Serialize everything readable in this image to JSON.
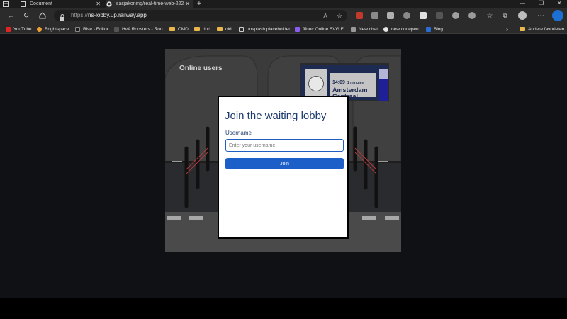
{
  "browser": {
    "tabs": [
      {
        "title": "Document",
        "active": false
      },
      {
        "title": "sasjakoning/real-time-web-2223",
        "active": true
      }
    ],
    "new_tab": "+",
    "url": {
      "scheme": "https://",
      "host": "ns-lobby.up.railway.app"
    },
    "bookmarks": [
      {
        "label": "YouTube"
      },
      {
        "label": "Brightspace"
      },
      {
        "label": "Rive - Editor"
      },
      {
        "label": "HvA Roosters - Roo..."
      },
      {
        "label": "CMD"
      },
      {
        "label": "dnd"
      },
      {
        "label": "old"
      },
      {
        "label": "unsplash placeholder"
      },
      {
        "label": "fffuuc Online SVG Fi..."
      },
      {
        "label": "New chat"
      },
      {
        "label": "new codepen"
      },
      {
        "label": "Bing"
      }
    ],
    "other_favorites": "Andere favorieten"
  },
  "scene": {
    "heading": "Online users",
    "departure_board": {
      "time": "14:09",
      "minutes": "1 minuten",
      "destination_line1": "Amsterdam",
      "destination_line2": "Centraal"
    }
  },
  "lobby": {
    "title": "Join the waiting lobby",
    "username_label": "Username",
    "username_value": "",
    "username_placeholder": "Enter your username",
    "join_label": "Join"
  },
  "colors": {
    "accent": "#1c5fc8",
    "title": "#1d3b6e",
    "page_bg": "#0f1115",
    "browser_chrome": "#2b2b2b"
  }
}
